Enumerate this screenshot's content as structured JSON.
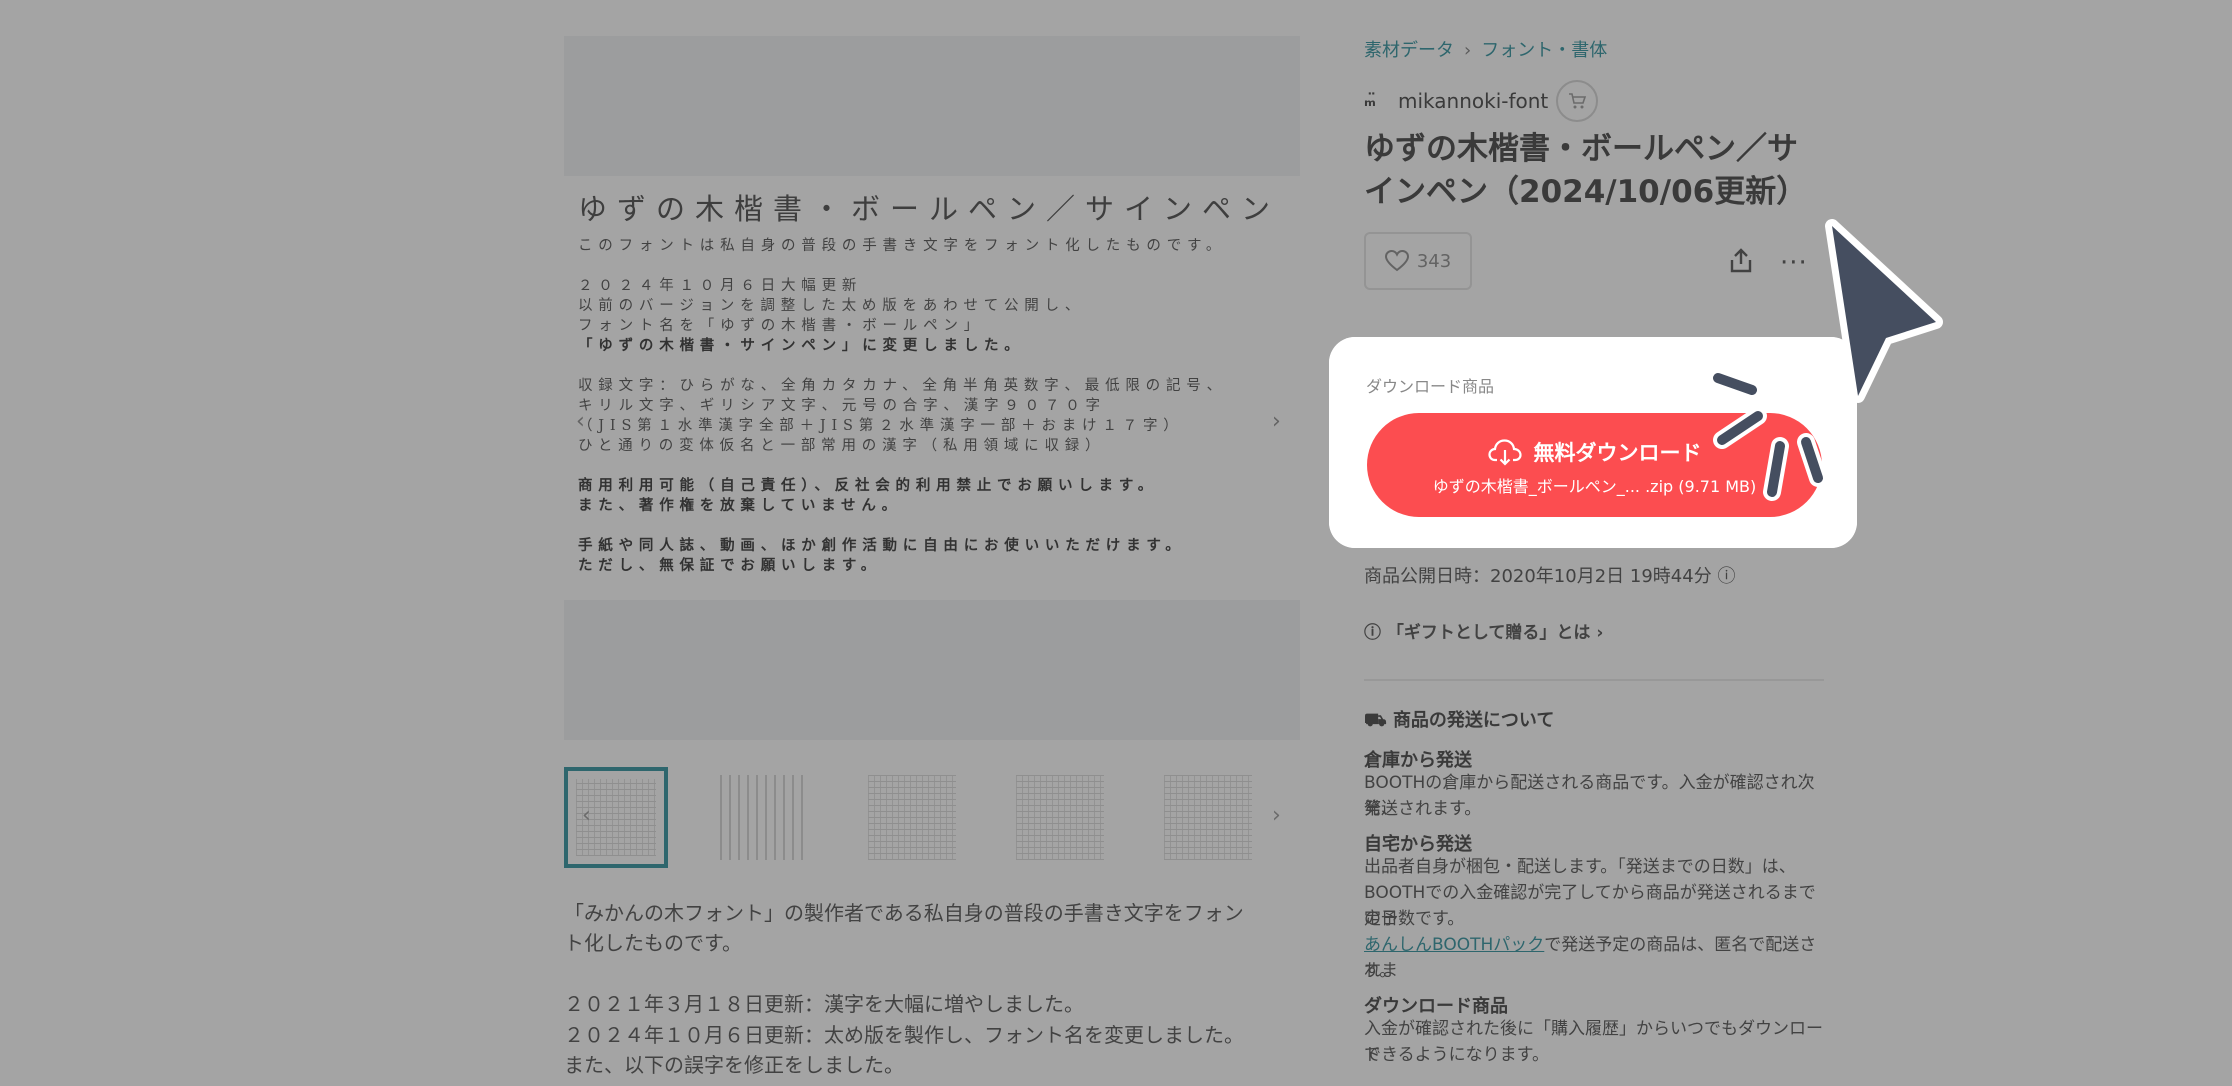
{
  "breadcrumb": {
    "item1": "素材データ",
    "item2": "フォント・書体"
  },
  "shop": {
    "name": "mikannoki-font"
  },
  "product": {
    "title": "ゆずの木楷書・ボールペン／サインペン（2024/10/06更新）",
    "likes": "343"
  },
  "gallery": {
    "sheet_title": "ゆずの木楷書・ボールペン／サインペン",
    "sheet_lines": [
      "このフォントは私自身の普段の手書き文字をフォント化したものです。",
      "２０２４年１０月６日大幅更新",
      "以前のバージョンを調整した太め版をあわせて公開し、",
      "フォント名を「ゆずの木楷書・ボールペン」",
      "「ゆずの木楷書・サインペン」に変更しました。",
      "収録文字：ひらがな、全角カタカナ、全角半角英数字、最低限の記号、",
      "キリル文字、ギリシア文字、元号の合字、漢字９０７０字",
      "（JIS第１水準漢字全部＋JIS第２水準漢字一部＋おまけ１７字）",
      "ひと通りの変体仮名と一部常用の漢字（私用領域に収録）",
      "商用利用可能（自己責任）、反社会的利用禁止でお願いします。",
      "また、著作権を放棄していません。",
      "手紙や同人誌、動画、ほか創作活動に自由にお使いいただけます。",
      "ただし、無保証でお願いします。"
    ]
  },
  "description": {
    "line1": "「みかんの木フォント」の製作者である私自身の普段の手書き文字をフォン",
    "line2": "ト化したものです。",
    "line3": "２０２１年３月１８日更新：漢字を大幅に増やしました。",
    "line4": "２０２４年１０月６日更新：太め版を製作し、フォント名を変更しました。",
    "line5": "また、以下の誤字を修正をしました。"
  },
  "download": {
    "section_label": "ダウンロード商品",
    "button_label": "無料ダウンロード",
    "file_info": "ゆずの木楷書_ボールペン_...  .zip (9.71 MB)"
  },
  "info": {
    "published": "商品公開日時：2020年10月2日 19時44分",
    "gift_link": "「ギフトとして贈る」とは",
    "shipping_title": "商品の発送について",
    "warehouse_head": "倉庫から発送",
    "warehouse_text1": "BOOTHの倉庫から配送される商品です。入金が確認され次第、",
    "warehouse_text2": "発送されます。",
    "home_head": "自宅から発送",
    "home_text1": "出品者自身が梱包・配送します。「発送までの日数」は、",
    "home_text2": "BOOTHでの入金確認が完了してから商品が発送されるまでの予",
    "home_text3": "定日数です。",
    "anshin_link": "あんしんBOOTHパック",
    "anshin_text1": "で発送予定の商品は、匿名で配送されま",
    "anshin_text2": "す。",
    "dl_head": "ダウンロード商品",
    "dl_text1": "入金が確認された後に「購入履歴」からいつでもダウンロード",
    "dl_text2": "できるようになります。"
  },
  "colors": {
    "accent": "#0a7e8c",
    "download_button": "#fc4d50",
    "cursor": "#454e60"
  }
}
